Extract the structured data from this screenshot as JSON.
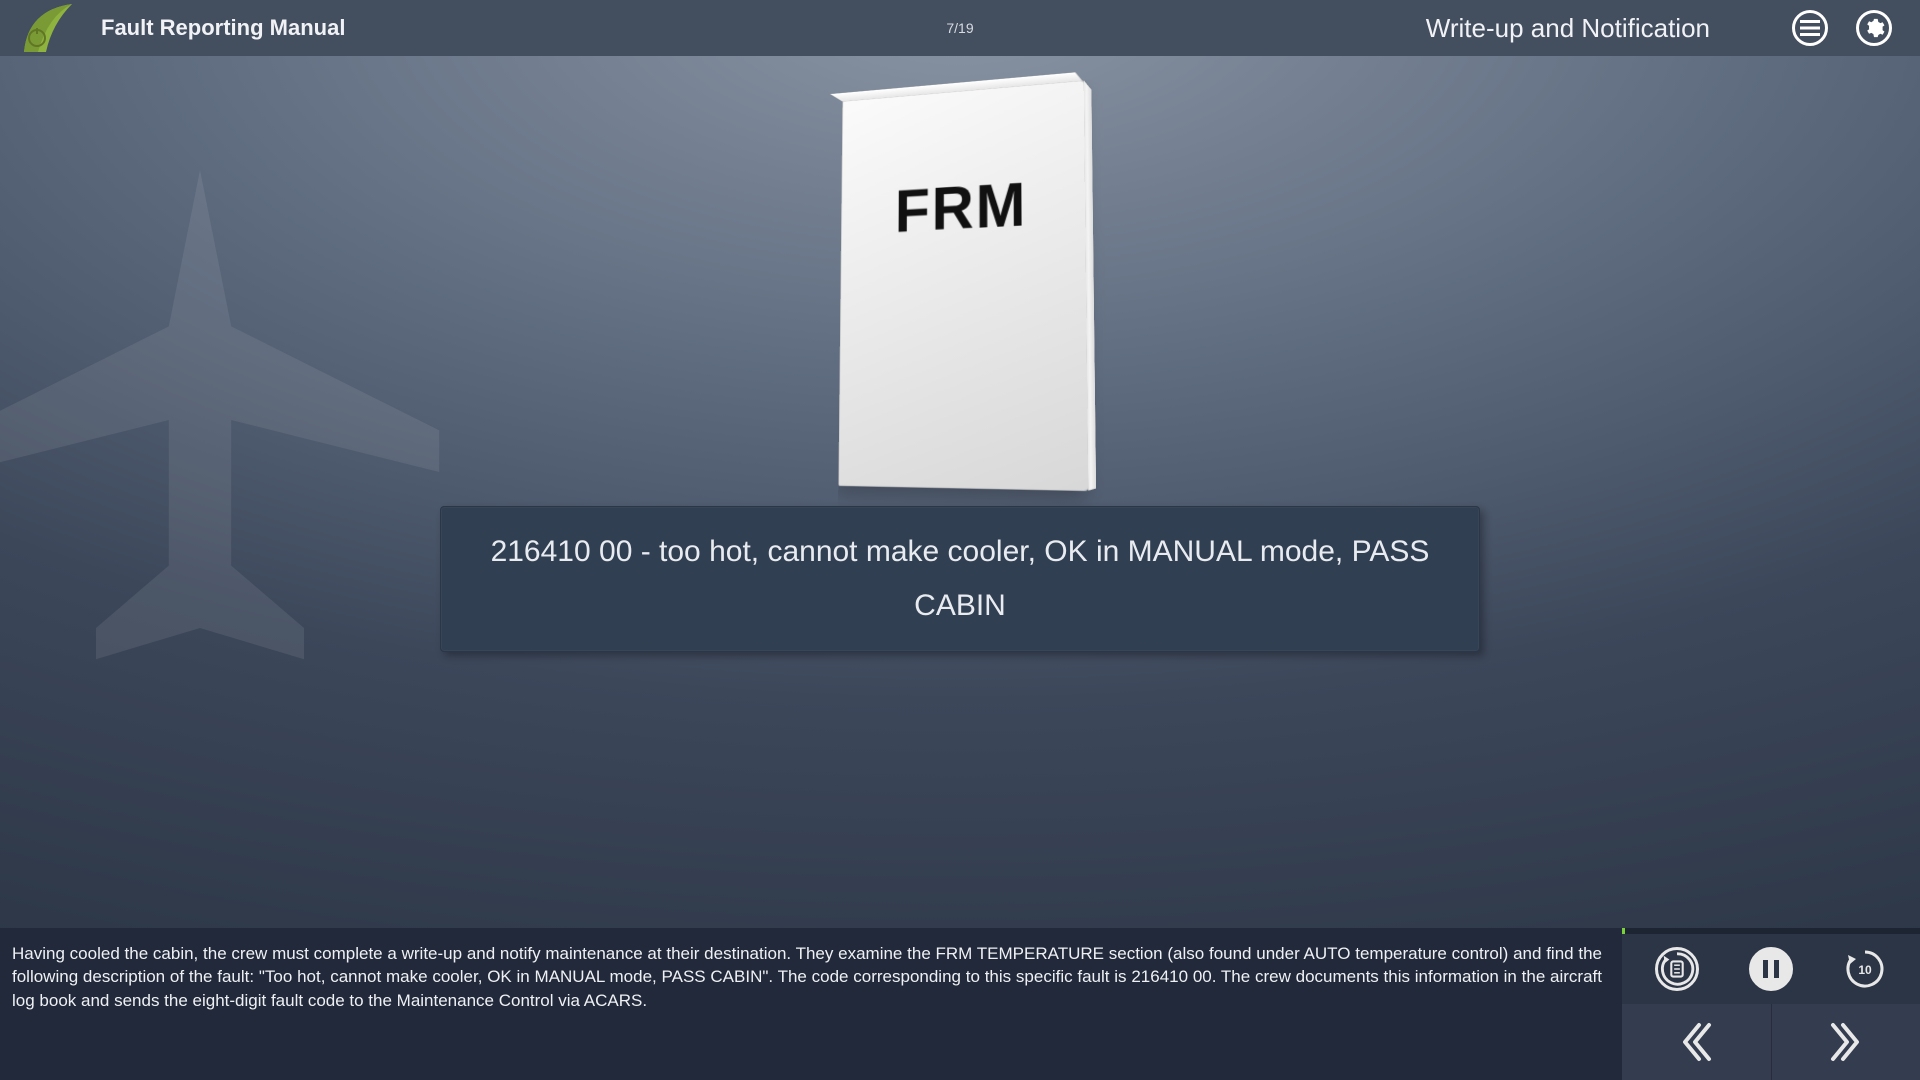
{
  "header": {
    "course_title": "Fault Reporting Manual",
    "page_counter": "7/19",
    "section_title": "Write-up and Notification"
  },
  "book": {
    "cover_label": "FRM"
  },
  "fault_box": {
    "text": "216410 00 - too hot, cannot make cooler, OK in MANUAL mode, PASS CABIN"
  },
  "narration": {
    "text": "Having cooled the cabin, the crew must complete a write-up and notify maintenance at their destination. They examine the FRM TEMPERATURE section (also found under AUTO temperature control) and find the following description of the fault: \"Too hot, cannot make cooler, OK in MANUAL mode, PASS CABIN\". The code corresponding to this specific fault is 216410 00. The crew documents this information in the aircraft log book and sends the eight-digit fault code to the Maintenance Control via ACARS."
  },
  "controls": {
    "rewind_seconds": "10",
    "progress_percent": 1
  }
}
